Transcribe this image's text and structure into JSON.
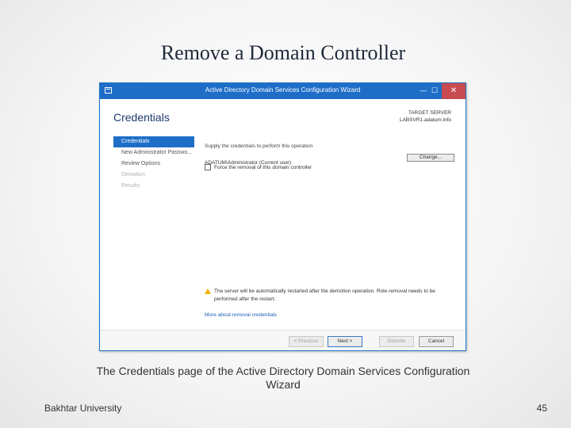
{
  "slide": {
    "title": "Remove a Domain Controller",
    "caption": "The Credentials page of the Active Directory Domain Services Configuration Wizard",
    "footer_left": "Bakhtar University",
    "page_number": "45"
  },
  "window": {
    "title": "Active Directory Domain Services Configuration Wizard",
    "app_icon": "server-manager-icon",
    "controls": {
      "minimize": "—",
      "maximize": "☐",
      "close": "✕"
    },
    "accent": "#1e6ec8",
    "close_color": "#c74b50"
  },
  "page": {
    "heading": "Credentials",
    "target_label": "TARGET SERVER",
    "target_name": "LABSVR1.adatum.info"
  },
  "nav": {
    "items": [
      {
        "label": "Credentials",
        "state": "active"
      },
      {
        "label": "New Administrator Passwo...",
        "state": "normal"
      },
      {
        "label": "Review Options",
        "state": "normal"
      },
      {
        "label": "Demotion",
        "state": "disabled"
      },
      {
        "label": "Results",
        "state": "disabled"
      }
    ]
  },
  "content": {
    "instruction": "Supply the credentials to perform this operation",
    "account": "ADATUM\\Administrator (Current user)",
    "change_button": "Change...",
    "force_removal_label": "Force the removal of this domain controller",
    "force_removal_checked": false,
    "warning_icon": "warning-icon",
    "warning_color": "#f0b400",
    "warning_text": "The server will be automatically restarted after the demotion operation. Role removal needs to be performed after the restart.",
    "more_link": "More about removal credentials"
  },
  "buttons": {
    "previous": "< Previous",
    "next": "Next >",
    "demote": "Demote",
    "cancel": "Cancel"
  }
}
